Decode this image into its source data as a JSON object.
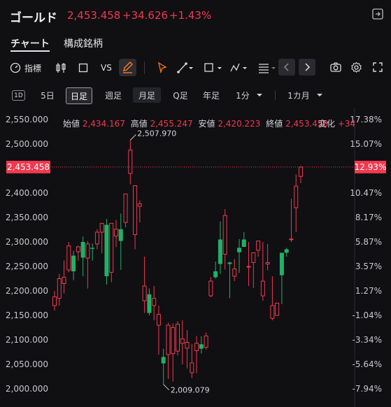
{
  "header": {
    "title": "ゴールド",
    "price": "2,453.458",
    "change": "+34.626",
    "change_pct": "+1.43%"
  },
  "tabs": [
    {
      "label": "チャート",
      "active": true
    },
    {
      "label": "構成銘柄",
      "active": false
    }
  ],
  "toolbar": {
    "indicators_label": "指標",
    "compare_label": "VS"
  },
  "timeframes": [
    {
      "label": "1D",
      "active": false
    },
    {
      "label": "5日",
      "active": false
    },
    {
      "label": "日足",
      "active": true
    },
    {
      "label": "週足",
      "active": false
    },
    {
      "label": "月足",
      "active": false
    },
    {
      "label": "Q足",
      "active": false
    },
    {
      "label": "年足",
      "active": false
    },
    {
      "label": "1分",
      "active": false
    },
    {
      "label": "1カ月",
      "active": false
    }
  ],
  "ohlc": {
    "open_label": "始値",
    "open": "2,434.167",
    "high_label": "高値",
    "high": "2,455.247",
    "low_label": "安値",
    "low": "2,420.223",
    "close_label": "終値",
    "close": "2,453.458",
    "change_label": "変化",
    "change": "+34."
  },
  "colors": {
    "up": "#22b066",
    "down": "#f2384f",
    "background": "#101013"
  },
  "chart_data": {
    "type": "candlestick",
    "y_ticks": [
      "2,550.000",
      "2,500.000",
      "2,450.000",
      "2,400.000",
      "2,350.000",
      "2,300.000",
      "2,250.000",
      "2,200.000",
      "2,150.000",
      "2,100.000",
      "2,050.000",
      "2,000.000"
    ],
    "pct_ticks": [
      "17.38%",
      "15.07%",
      "12.93%",
      "10.47%",
      "8.17%",
      "5.87%",
      "3.57%",
      "1.27%",
      "-1.04%",
      "-3.34%",
      "-5.64%",
      "-7.94%"
    ],
    "current_price_label": "2,453.458",
    "current_pct_label": "12.93%",
    "high_annotation": "2,507.970",
    "low_annotation": "2,009.079",
    "candles": [
      {
        "o": 2170,
        "h": 2200,
        "l": 2160,
        "c": 2188
      },
      {
        "o": 2185,
        "h": 2235,
        "l": 2170,
        "c": 2225
      },
      {
        "o": 2215,
        "h": 2262,
        "l": 2195,
        "c": 2228
      },
      {
        "o": 2243,
        "h": 2300,
        "l": 2238,
        "c": 2292
      },
      {
        "o": 2272,
        "h": 2282,
        "l": 2222,
        "c": 2240
      },
      {
        "o": 2280,
        "h": 2292,
        "l": 2262,
        "c": 2290
      },
      {
        "o": 2300,
        "h": 2311,
        "l": 2230,
        "c": 2268
      },
      {
        "o": 2267,
        "h": 2302,
        "l": 2205,
        "c": 2296
      },
      {
        "o": 2288,
        "h": 2297,
        "l": 2262,
        "c": 2286
      },
      {
        "o": 2296,
        "h": 2326,
        "l": 2285,
        "c": 2320
      },
      {
        "o": 2320,
        "h": 2338,
        "l": 2277,
        "c": 2338
      },
      {
        "o": 2335,
        "h": 2347,
        "l": 2213,
        "c": 2230
      },
      {
        "o": 2238,
        "h": 2338,
        "l": 2218,
        "c": 2338
      },
      {
        "o": 2312,
        "h": 2345,
        "l": 2290,
        "c": 2326
      },
      {
        "o": 2326,
        "h": 2358,
        "l": 2243,
        "c": 2302
      },
      {
        "o": 2340,
        "h": 2398,
        "l": 2330,
        "c": 2398
      },
      {
        "o": 2440,
        "h": 2508,
        "l": 2418,
        "c": 2488
      },
      {
        "o": 2315,
        "h": 2385,
        "l": 2285,
        "c": 2415
      },
      {
        "o": 2373,
        "h": 2385,
        "l": 2340,
        "c": 2378
      },
      {
        "o": 2180,
        "h": 2270,
        "l": 2155,
        "c": 2210
      },
      {
        "o": 2193,
        "h": 2205,
        "l": 2150,
        "c": 2155
      },
      {
        "o": 2170,
        "h": 2210,
        "l": 2140,
        "c": 2185
      },
      {
        "o": 2130,
        "h": 2170,
        "l": 2070,
        "c": 2152
      },
      {
        "o": 2065,
        "h": 2082,
        "l": 2009,
        "c": 2052
      },
      {
        "o": 2070,
        "h": 2135,
        "l": 2020,
        "c": 2130
      },
      {
        "o": 2072,
        "h": 2134,
        "l": 2015,
        "c": 2125
      },
      {
        "o": 2077,
        "h": 2138,
        "l": 2068,
        "c": 2132
      },
      {
        "o": 2093,
        "h": 2140,
        "l": 2050,
        "c": 2102
      },
      {
        "o": 2083,
        "h": 2120,
        "l": 2042,
        "c": 2095
      },
      {
        "o": 2033,
        "h": 2092,
        "l": 2022,
        "c": 2053
      },
      {
        "o": 2078,
        "h": 2108,
        "l": 2032,
        "c": 2093
      },
      {
        "o": 2091,
        "h": 2107,
        "l": 2072,
        "c": 2082
      },
      {
        "o": 2085,
        "h": 2115,
        "l": 2080,
        "c": 2108
      },
      {
        "o": 2190,
        "h": 2228,
        "l": 2187,
        "c": 2220
      },
      {
        "o": 2240,
        "h": 2260,
        "l": 2225,
        "c": 2228
      },
      {
        "o": 2305,
        "h": 2342,
        "l": 2235,
        "c": 2255
      },
      {
        "o": 2275,
        "h": 2367,
        "l": 2244,
        "c": 2354
      },
      {
        "o": 2258,
        "h": 2260,
        "l": 2185,
        "c": 2255
      },
      {
        "o": 2230,
        "h": 2265,
        "l": 2220,
        "c": 2245
      },
      {
        "o": 2288,
        "h": 2306,
        "l": 2237,
        "c": 2279
      },
      {
        "o": 2305,
        "h": 2320,
        "l": 2295,
        "c": 2290
      },
      {
        "o": 2250,
        "h": 2300,
        "l": 2210,
        "c": 2250
      },
      {
        "o": 2258,
        "h": 2275,
        "l": 2206,
        "c": 2278
      },
      {
        "o": 2283,
        "h": 2302,
        "l": 2270,
        "c": 2302
      },
      {
        "o": 2190,
        "h": 2300,
        "l": 2180,
        "c": 2220
      },
      {
        "o": 2255,
        "h": 2296,
        "l": 2242,
        "c": 2258
      },
      {
        "o": 2144,
        "h": 2230,
        "l": 2140,
        "c": 2170
      },
      {
        "o": 2150,
        "h": 2175,
        "l": 2155,
        "c": 2175
      },
      {
        "o": 2278,
        "h": 2277,
        "l": 2173,
        "c": 2232
      },
      {
        "o": 2285,
        "h": 2288,
        "l": 2270,
        "c": 2278
      },
      {
        "o": 2306,
        "h": 2388,
        "l": 2300,
        "c": 2306
      },
      {
        "o": 2370,
        "h": 2438,
        "l": 2320,
        "c": 2414
      },
      {
        "o": 2434,
        "h": 2455,
        "l": 2420,
        "c": 2453
      }
    ]
  }
}
